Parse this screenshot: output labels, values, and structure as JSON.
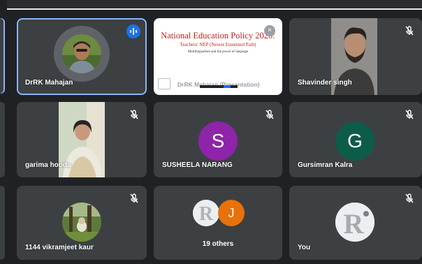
{
  "colors": {
    "tile_bg": "#3c4043",
    "page_bg": "#202124",
    "active_border": "#8ab4f8",
    "speaking_badge": "#1a73e8",
    "avatar_S": "#8e24aa",
    "avatar_G": "#0d5c4a",
    "avatar_J": "#e8710a"
  },
  "participants": {
    "drk": {
      "name": "DrRK Mahajan",
      "speaking": true
    },
    "presentation": {
      "slide_title": "National Education Policy 2020:",
      "slide_subtitle": "Teachers' NEP (Newer Esteemed Path)",
      "slide_line": "Multilingualism and the power of language",
      "caption": "DrRK Mahajan (Presentation)",
      "close_icon": "×"
    },
    "shavinder": {
      "name": "Shavinder singh"
    },
    "garima": {
      "name": "garima hooda"
    },
    "susheela": {
      "name": "SUSHEELA NARANG",
      "initial": "S"
    },
    "gursimran": {
      "name": "Gursimran Kalra",
      "initial": "G"
    },
    "vikramjeet": {
      "name": "1144 vikramjeet kaur"
    },
    "others": {
      "label": "19 others",
      "initial": "J"
    },
    "you": {
      "name": "You"
    }
  }
}
